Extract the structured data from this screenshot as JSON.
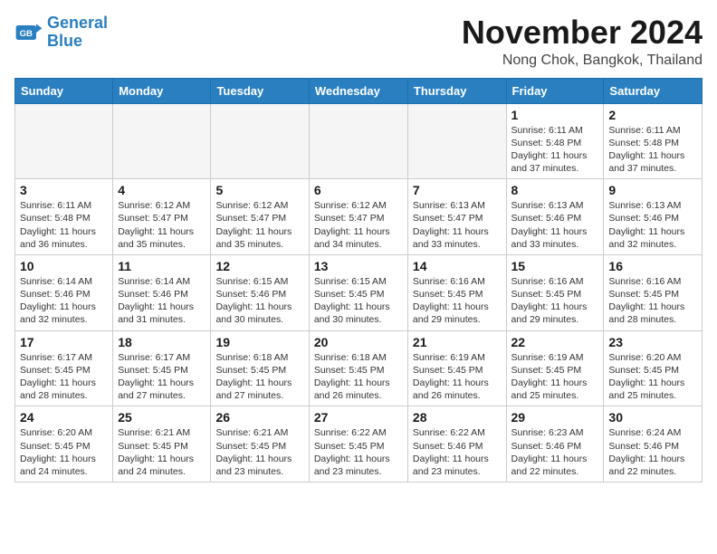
{
  "header": {
    "logo_general": "General",
    "logo_blue": "Blue",
    "month_title": "November 2024",
    "location": "Nong Chok, Bangkok, Thailand"
  },
  "weekdays": [
    "Sunday",
    "Monday",
    "Tuesday",
    "Wednesday",
    "Thursday",
    "Friday",
    "Saturday"
  ],
  "weeks": [
    [
      {
        "day": "",
        "sunrise": "",
        "sunset": "",
        "daylight": "",
        "empty": true
      },
      {
        "day": "",
        "sunrise": "",
        "sunset": "",
        "daylight": "",
        "empty": true
      },
      {
        "day": "",
        "sunrise": "",
        "sunset": "",
        "daylight": "",
        "empty": true
      },
      {
        "day": "",
        "sunrise": "",
        "sunset": "",
        "daylight": "",
        "empty": true
      },
      {
        "day": "",
        "sunrise": "",
        "sunset": "",
        "daylight": "",
        "empty": true
      },
      {
        "day": "1",
        "sunrise": "Sunrise: 6:11 AM",
        "sunset": "Sunset: 5:48 PM",
        "daylight": "Daylight: 11 hours and 37 minutes.",
        "empty": false
      },
      {
        "day": "2",
        "sunrise": "Sunrise: 6:11 AM",
        "sunset": "Sunset: 5:48 PM",
        "daylight": "Daylight: 11 hours and 37 minutes.",
        "empty": false
      }
    ],
    [
      {
        "day": "3",
        "sunrise": "Sunrise: 6:11 AM",
        "sunset": "Sunset: 5:48 PM",
        "daylight": "Daylight: 11 hours and 36 minutes.",
        "empty": false
      },
      {
        "day": "4",
        "sunrise": "Sunrise: 6:12 AM",
        "sunset": "Sunset: 5:47 PM",
        "daylight": "Daylight: 11 hours and 35 minutes.",
        "empty": false
      },
      {
        "day": "5",
        "sunrise": "Sunrise: 6:12 AM",
        "sunset": "Sunset: 5:47 PM",
        "daylight": "Daylight: 11 hours and 35 minutes.",
        "empty": false
      },
      {
        "day": "6",
        "sunrise": "Sunrise: 6:12 AM",
        "sunset": "Sunset: 5:47 PM",
        "daylight": "Daylight: 11 hours and 34 minutes.",
        "empty": false
      },
      {
        "day": "7",
        "sunrise": "Sunrise: 6:13 AM",
        "sunset": "Sunset: 5:47 PM",
        "daylight": "Daylight: 11 hours and 33 minutes.",
        "empty": false
      },
      {
        "day": "8",
        "sunrise": "Sunrise: 6:13 AM",
        "sunset": "Sunset: 5:46 PM",
        "daylight": "Daylight: 11 hours and 33 minutes.",
        "empty": false
      },
      {
        "day": "9",
        "sunrise": "Sunrise: 6:13 AM",
        "sunset": "Sunset: 5:46 PM",
        "daylight": "Daylight: 11 hours and 32 minutes.",
        "empty": false
      }
    ],
    [
      {
        "day": "10",
        "sunrise": "Sunrise: 6:14 AM",
        "sunset": "Sunset: 5:46 PM",
        "daylight": "Daylight: 11 hours and 32 minutes.",
        "empty": false
      },
      {
        "day": "11",
        "sunrise": "Sunrise: 6:14 AM",
        "sunset": "Sunset: 5:46 PM",
        "daylight": "Daylight: 11 hours and 31 minutes.",
        "empty": false
      },
      {
        "day": "12",
        "sunrise": "Sunrise: 6:15 AM",
        "sunset": "Sunset: 5:46 PM",
        "daylight": "Daylight: 11 hours and 30 minutes.",
        "empty": false
      },
      {
        "day": "13",
        "sunrise": "Sunrise: 6:15 AM",
        "sunset": "Sunset: 5:45 PM",
        "daylight": "Daylight: 11 hours and 30 minutes.",
        "empty": false
      },
      {
        "day": "14",
        "sunrise": "Sunrise: 6:16 AM",
        "sunset": "Sunset: 5:45 PM",
        "daylight": "Daylight: 11 hours and 29 minutes.",
        "empty": false
      },
      {
        "day": "15",
        "sunrise": "Sunrise: 6:16 AM",
        "sunset": "Sunset: 5:45 PM",
        "daylight": "Daylight: 11 hours and 29 minutes.",
        "empty": false
      },
      {
        "day": "16",
        "sunrise": "Sunrise: 6:16 AM",
        "sunset": "Sunset: 5:45 PM",
        "daylight": "Daylight: 11 hours and 28 minutes.",
        "empty": false
      }
    ],
    [
      {
        "day": "17",
        "sunrise": "Sunrise: 6:17 AM",
        "sunset": "Sunset: 5:45 PM",
        "daylight": "Daylight: 11 hours and 28 minutes.",
        "empty": false
      },
      {
        "day": "18",
        "sunrise": "Sunrise: 6:17 AM",
        "sunset": "Sunset: 5:45 PM",
        "daylight": "Daylight: 11 hours and 27 minutes.",
        "empty": false
      },
      {
        "day": "19",
        "sunrise": "Sunrise: 6:18 AM",
        "sunset": "Sunset: 5:45 PM",
        "daylight": "Daylight: 11 hours and 27 minutes.",
        "empty": false
      },
      {
        "day": "20",
        "sunrise": "Sunrise: 6:18 AM",
        "sunset": "Sunset: 5:45 PM",
        "daylight": "Daylight: 11 hours and 26 minutes.",
        "empty": false
      },
      {
        "day": "21",
        "sunrise": "Sunrise: 6:19 AM",
        "sunset": "Sunset: 5:45 PM",
        "daylight": "Daylight: 11 hours and 26 minutes.",
        "empty": false
      },
      {
        "day": "22",
        "sunrise": "Sunrise: 6:19 AM",
        "sunset": "Sunset: 5:45 PM",
        "daylight": "Daylight: 11 hours and 25 minutes.",
        "empty": false
      },
      {
        "day": "23",
        "sunrise": "Sunrise: 6:20 AM",
        "sunset": "Sunset: 5:45 PM",
        "daylight": "Daylight: 11 hours and 25 minutes.",
        "empty": false
      }
    ],
    [
      {
        "day": "24",
        "sunrise": "Sunrise: 6:20 AM",
        "sunset": "Sunset: 5:45 PM",
        "daylight": "Daylight: 11 hours and 24 minutes.",
        "empty": false
      },
      {
        "day": "25",
        "sunrise": "Sunrise: 6:21 AM",
        "sunset": "Sunset: 5:45 PM",
        "daylight": "Daylight: 11 hours and 24 minutes.",
        "empty": false
      },
      {
        "day": "26",
        "sunrise": "Sunrise: 6:21 AM",
        "sunset": "Sunset: 5:45 PM",
        "daylight": "Daylight: 11 hours and 23 minutes.",
        "empty": false
      },
      {
        "day": "27",
        "sunrise": "Sunrise: 6:22 AM",
        "sunset": "Sunset: 5:45 PM",
        "daylight": "Daylight: 11 hours and 23 minutes.",
        "empty": false
      },
      {
        "day": "28",
        "sunrise": "Sunrise: 6:22 AM",
        "sunset": "Sunset: 5:46 PM",
        "daylight": "Daylight: 11 hours and 23 minutes.",
        "empty": false
      },
      {
        "day": "29",
        "sunrise": "Sunrise: 6:23 AM",
        "sunset": "Sunset: 5:46 PM",
        "daylight": "Daylight: 11 hours and 22 minutes.",
        "empty": false
      },
      {
        "day": "30",
        "sunrise": "Sunrise: 6:24 AM",
        "sunset": "Sunset: 5:46 PM",
        "daylight": "Daylight: 11 hours and 22 minutes.",
        "empty": false
      }
    ]
  ]
}
